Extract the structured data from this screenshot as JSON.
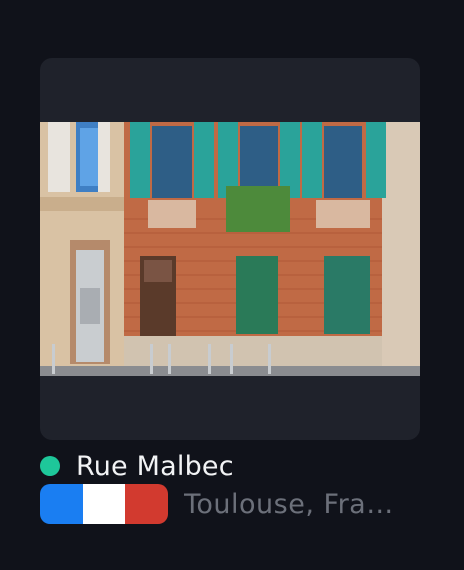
{
  "place": {
    "title": "Rue Malbec",
    "location": "Toulouse, Fra…",
    "status_color": "#1ec79a"
  },
  "flag": {
    "country": "France",
    "colors": [
      "#1a7ef2",
      "#ffffff",
      "#d23a2f"
    ]
  }
}
